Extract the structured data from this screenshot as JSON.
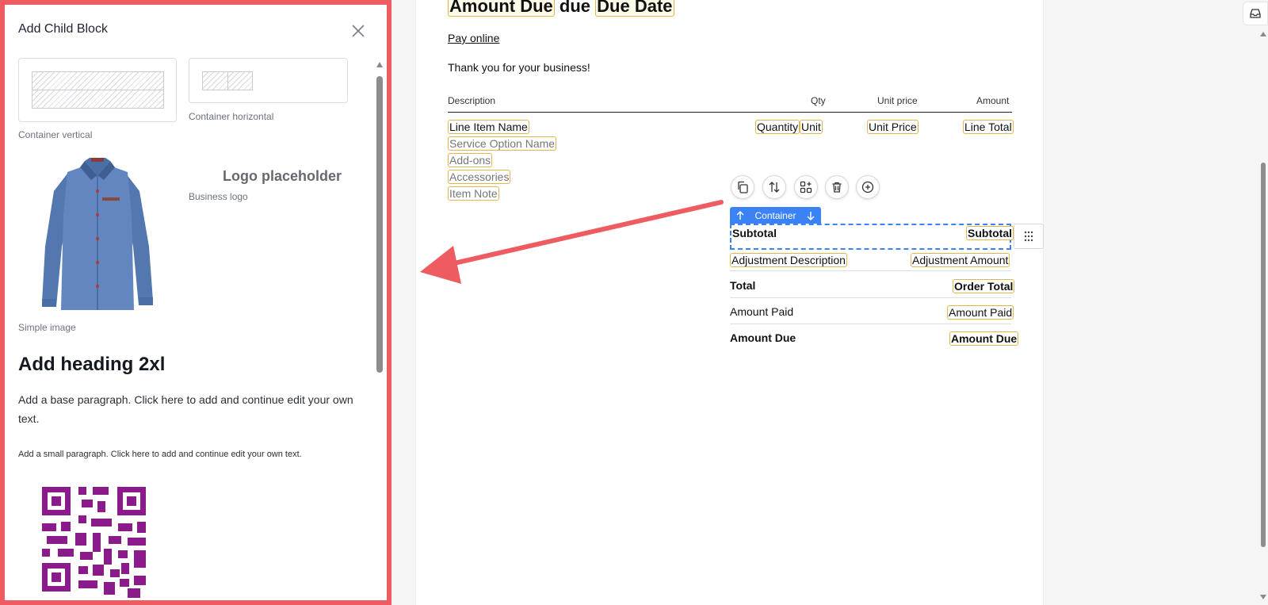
{
  "panel": {
    "title": "Add Child Block",
    "blocks": {
      "container_vertical": "Container vertical",
      "container_horizontal": "Container horizontal",
      "business_logo_placeholder": "Logo placeholder",
      "business_logo": "Business logo",
      "simple_image": "Simple image",
      "heading": "Add heading 2xl",
      "base_paragraph": "Add a base paragraph. Click here to add and continue edit your own text.",
      "small_paragraph": "Add a small paragraph. Click here to add and continue edit your own text."
    },
    "colors": {
      "border": "#ee5b60",
      "qr": "#8b1a8b",
      "shirt": "#5b80b8"
    }
  },
  "document": {
    "heading": {
      "amount_due": "Amount Due",
      "due_word": "due",
      "due_date": "Due Date"
    },
    "pay_online": "Pay online",
    "thanks": "Thank you for your business!",
    "columns": {
      "description": "Description",
      "qty": "Qty",
      "unit_price": "Unit price",
      "amount": "Amount"
    },
    "line_item": {
      "name": "Line Item Name",
      "quantity": "Quantity",
      "unit": "Unit",
      "unit_price": "Unit Price",
      "line_total": "Line Total",
      "service_option": "Service Option Name",
      "addons": "Add-ons",
      "accessories": "Accessories",
      "item_note": "Item Note"
    },
    "toolbar": {
      "container_label": "Container"
    },
    "totals": {
      "subtotal_label": "Subtotal",
      "subtotal_value": "Subtotal",
      "adjustment_desc": "Adjustment Description",
      "adjustment_amount": "Adjustment Amount",
      "total_label": "Total",
      "total_value": "Order Total",
      "paid_label": "Amount Paid",
      "paid_value": "Amount Paid",
      "due_label": "Amount Due",
      "due_value": "Amount Due"
    },
    "colors": {
      "field_border": "#e0b84a",
      "selection": "#3b82f6",
      "annotation_arrow": "#ee5b60"
    }
  }
}
